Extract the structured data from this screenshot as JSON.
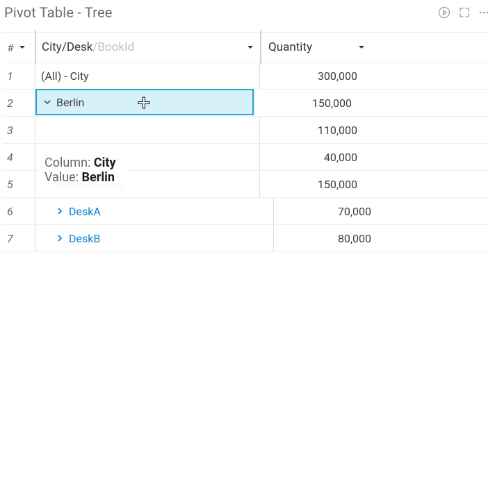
{
  "header": {
    "title": "Pivot Table - Tree"
  },
  "columns": {
    "idx": "#",
    "tree_parts": {
      "a": "City",
      "sep1": " / ",
      "b": "Desk",
      "sep2": " / ",
      "c": "BookId"
    },
    "quantity": "Quantity"
  },
  "rows": [
    {
      "idx": "1",
      "label": "(All) - City",
      "qty": "300,000",
      "kind": "root"
    },
    {
      "idx": "2",
      "label": "Berlin",
      "qty": "150,000",
      "kind": "city",
      "expanded": true,
      "selected": true
    },
    {
      "idx": "3",
      "label": "",
      "qty": "110,000",
      "kind": "blank"
    },
    {
      "idx": "4",
      "label": "",
      "qty": "40,000",
      "kind": "blank"
    },
    {
      "idx": "5",
      "label": "Johannesburg",
      "qty": "150,000",
      "kind": "city",
      "expanded": true
    },
    {
      "idx": "6",
      "label": "DeskA",
      "qty": "70,000",
      "kind": "desk"
    },
    {
      "idx": "7",
      "label": "DeskB",
      "qty": "80,000",
      "kind": "desk"
    }
  ],
  "tooltip": {
    "column_label": "Column: ",
    "column_value": "City",
    "value_label": "Value: ",
    "value_value": "Berlin"
  },
  "icons": {
    "run": "run-icon",
    "expand": "expand-icon",
    "more": "more-icon",
    "dropdown": "dropdown-icon",
    "chev_down": "chevron-down-icon",
    "chev_right": "chevron-right-icon",
    "plus_cursor": "plus-cursor-icon"
  }
}
